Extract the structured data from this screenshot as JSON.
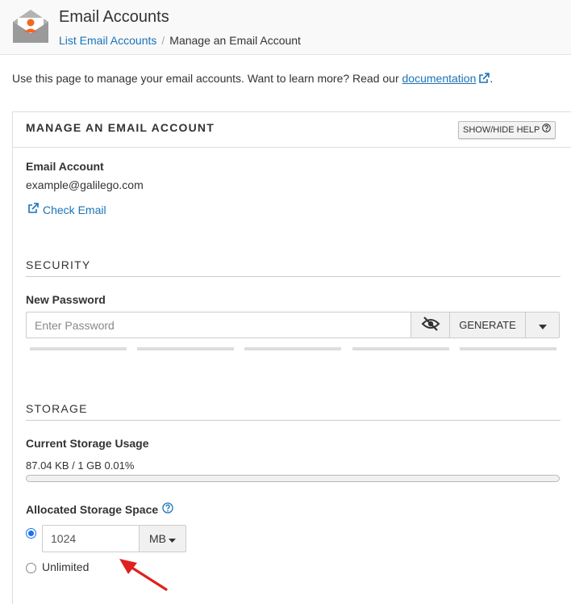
{
  "header": {
    "title": "Email Accounts",
    "breadcrumb": {
      "parent": "List Email Accounts",
      "separator": "/",
      "current": "Manage an Email Account"
    }
  },
  "intro": {
    "text": "Use this page to manage your email accounts. Want to learn more? Read our ",
    "link": "documentation",
    "suffix": "."
  },
  "panel": {
    "title": "MANAGE AN EMAIL ACCOUNT",
    "help_button": "SHOW/HIDE HELP",
    "account": {
      "label": "Email Account",
      "value": "example@galilego.com",
      "check_email": "Check Email"
    },
    "security": {
      "heading": "SECURITY",
      "new_password_label": "New Password",
      "password_placeholder": "Enter Password",
      "generate_label": "GENERATE"
    },
    "storage": {
      "heading": "STORAGE",
      "usage_label": "Current Storage Usage",
      "usage_text": "87.04 KB / 1 GB 0.01%",
      "usage_percent": 0.01,
      "allocated_label": "Allocated Storage Space",
      "quota_value": "1024",
      "unit": "MB",
      "unlimited_label": "Unlimited",
      "selected_option": "quota"
    }
  },
  "colors": {
    "link": "#1a73b8",
    "radio": "#1a73e8",
    "annotation_arrow": "#e02020",
    "brand_orange": "#f26722"
  }
}
